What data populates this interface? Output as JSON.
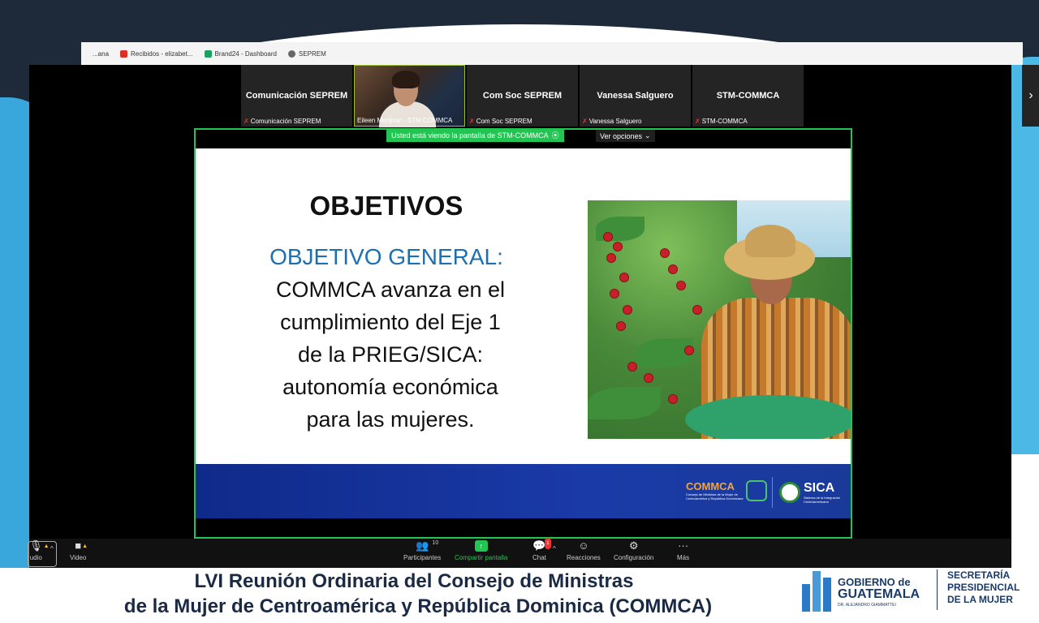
{
  "bookmarks": [
    {
      "label": "Recibidos - elizabet..."
    },
    {
      "label": "Brand24 - Dashboard"
    },
    {
      "label": "SEPREM"
    }
  ],
  "bookmarks_partial": "...ana",
  "participants_strip": [
    {
      "tile": "Comunicación SEPREM",
      "name": "Comunicación SEPREM"
    },
    {
      "tile": "",
      "name": "Eileen Menjivar - STM COMMCA"
    },
    {
      "tile": "Com Soc SEPREM",
      "name": "Com Soc SEPREM"
    },
    {
      "tile": "Vanessa Salguero",
      "name": "Vanessa Salguero"
    },
    {
      "tile": "STM-COMMCA",
      "name": "STM-COMMCA"
    }
  ],
  "share": {
    "banner": "Usted está viendo la pantalla de STM-COMMCA",
    "view_options": "Ver opciones"
  },
  "slide": {
    "title": "OBJETIVOS",
    "subtitle": "OBJETIVO GENERAL:",
    "body_lines": [
      "COMMCA avanza en el",
      "cumplimiento del Eje 1",
      "de la PRIEG/SICA:",
      "autonomía económica",
      "para las mujeres."
    ],
    "commca_logo": "COMMCA",
    "commca_small": "Consejo de Ministras de la Mujer de Centroamérica y República Dominicana",
    "sica_logo": "SICA",
    "sica_small": "Sistema de la Integración Centroamericana"
  },
  "toolbar": {
    "audio": "udio",
    "video": "Video",
    "participants": "Participantes",
    "participants_count": "10",
    "share": "Compartir pantalla",
    "chat": "Chat",
    "chat_badge": "1",
    "reactions": "Reacciones",
    "settings": "Configuración",
    "more": "Más"
  },
  "caption": {
    "line1": "LVI Reunión Ordinaria del Consejo de Ministras",
    "line2": "de la Mujer de Centroamérica y República Dominica (COMMCA)"
  },
  "gob_logo": {
    "line1": "GOBIERNO de",
    "line2": "GUATEMALA",
    "line3": "DR. ALEJANDRO GIAMMATTEI"
  },
  "sec_logo": {
    "line1": "SECRETARÍA",
    "line2": "PRESIDENCIAL",
    "line3": "DE LA MUJER"
  },
  "colors": {
    "accent_green": "#23c552",
    "slide_blue": "#1c6fb0",
    "footer_blue": "#1a3aa8",
    "caption_text": "#1a2a44"
  }
}
